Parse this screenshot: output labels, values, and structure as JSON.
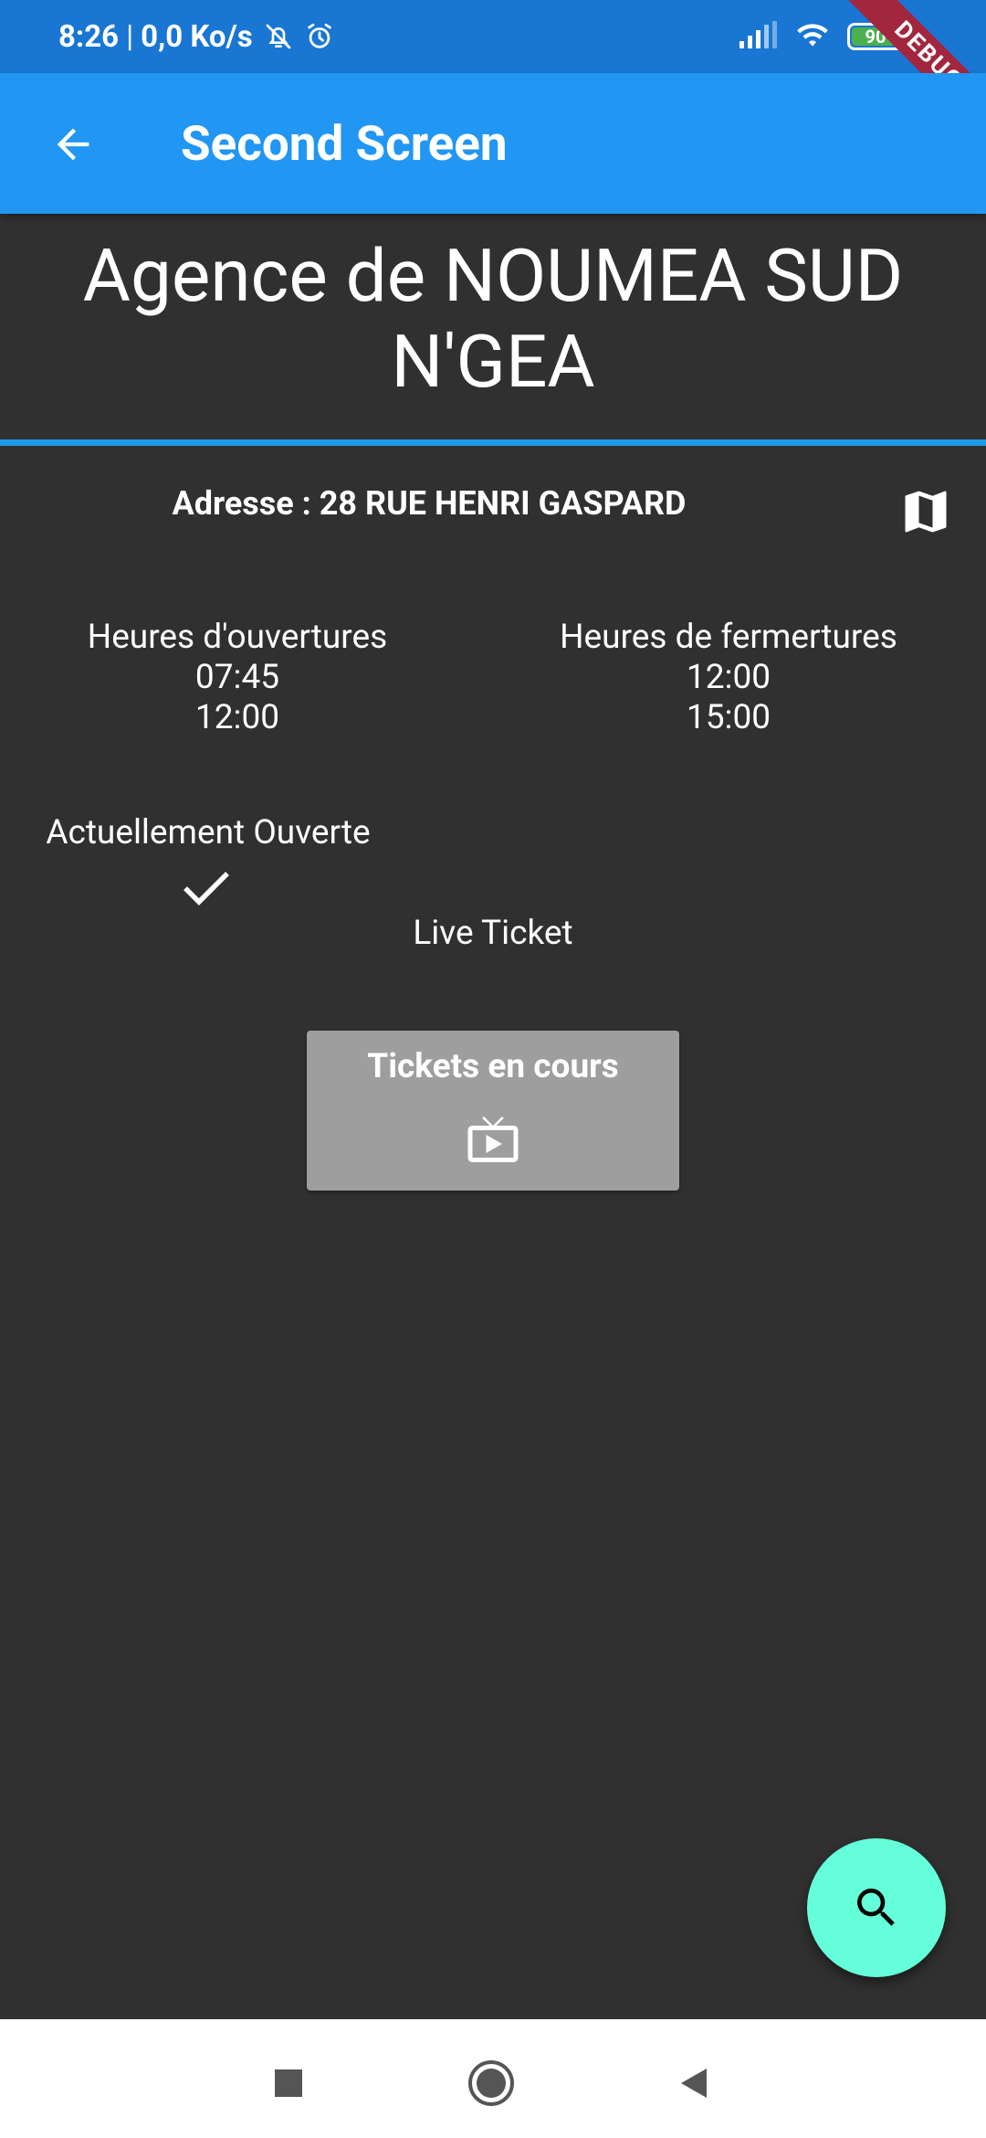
{
  "status_bar": {
    "time": "8:26",
    "network_speed": "0,0 Ko/s",
    "battery_level": "90",
    "icons": [
      "bell-off-icon",
      "alarm-icon",
      "signal-icon",
      "wifi-icon",
      "battery-icon"
    ]
  },
  "debug_banner": "DEBUG",
  "app_bar": {
    "title": "Second Screen",
    "back_icon": "arrow-back-icon"
  },
  "agency": {
    "title": "Agence de NOUMEA SUD N'GEA",
    "address": "Adresse : 28 RUE HENRI GASPARD",
    "map_icon": "map-icon"
  },
  "hours": {
    "opening_label": "Heures d'ouvertures",
    "opening_times": [
      "07:45",
      "12:00"
    ],
    "closing_label": "Heures de fermertures",
    "closing_times": [
      "12:00",
      "15:00"
    ]
  },
  "status": {
    "label": "Actuellement Ouverte",
    "icon": "check-icon"
  },
  "live_ticket": {
    "label": "Live Ticket",
    "button_label": "Tickets en cours",
    "button_icon": "live-tv-icon"
  },
  "fab": {
    "icon": "search-icon"
  },
  "colors": {
    "background": "#303030",
    "app_bar": "#2196f3",
    "status_bar": "#1976d2",
    "divider": "#1e9be8",
    "fab": "#64ffda",
    "ticket_button": "#9e9e9e"
  }
}
